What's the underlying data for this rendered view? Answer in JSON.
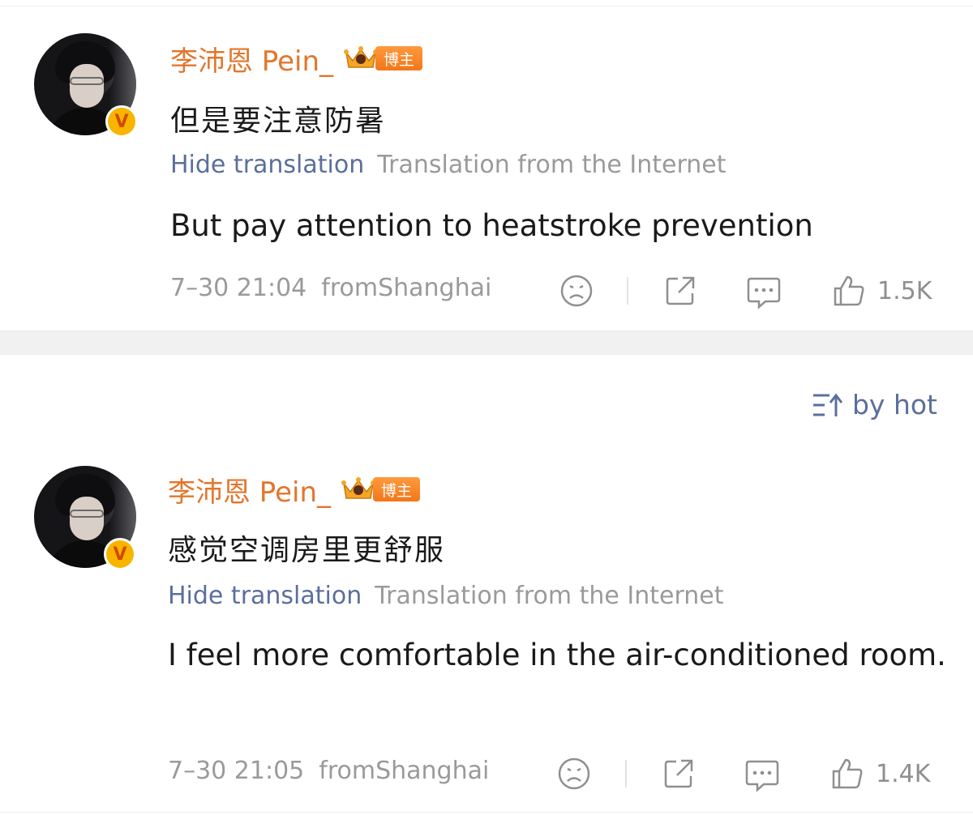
{
  "comments": [
    {
      "username": "李沛恩 Pein_",
      "badge_label": "博主",
      "verified_mark": "V",
      "text_original": "但是要注意防暑",
      "hide_translation_label": "Hide translation",
      "translation_source": "Translation from the Internet",
      "text_translated": "But pay attention to heatstroke prevention",
      "date": "7–30 21:04",
      "location": "fromShanghai",
      "like_count": "1.5K"
    },
    {
      "username": "李沛恩 Pein_",
      "badge_label": "博主",
      "verified_mark": "V",
      "text_original": "感觉空调房里更舒服",
      "hide_translation_label": "Hide translation",
      "translation_source": "Translation from the Internet",
      "text_translated": "I feel more comfortable in the air-conditioned room.",
      "date": "7–30 21:05",
      "location": "fromShanghai",
      "like_count": "1.4K"
    }
  ],
  "sort": {
    "label": "by hot"
  },
  "icons": {
    "emoji": "sad-face-icon",
    "repost": "share-icon",
    "comment": "comment-icon",
    "like": "thumbs-up-icon",
    "sort": "sort-icon",
    "crown": "crown-icon"
  },
  "colors": {
    "username": "#e2762c",
    "link": "#5b6f9c",
    "muted": "#9a9a9a",
    "badge": "#f27719",
    "verified": "#f7b500"
  }
}
